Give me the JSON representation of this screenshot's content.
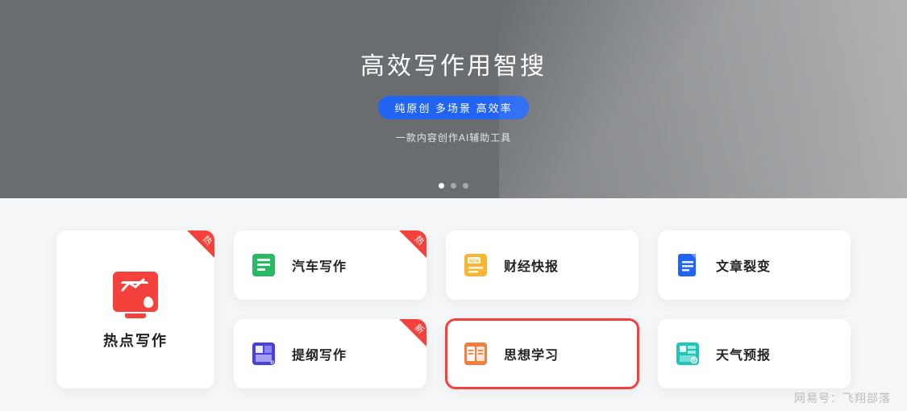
{
  "hero": {
    "title": "高效写作用智搜",
    "pill": "纯原创 多场景 高效率",
    "subtitle": "一款内容创作AI辅助工具"
  },
  "ribbons": {
    "hot": "热",
    "new": "新"
  },
  "featured": {
    "label": "热点写作",
    "color": "#f4413b"
  },
  "cards": [
    {
      "label": "汽车写作",
      "color": "#2ab964",
      "ribbon": "hot"
    },
    {
      "label": "财经快报",
      "color": "#f7b530"
    },
    {
      "label": "文章裂变",
      "color": "#2164f4"
    },
    {
      "label": "提纲写作",
      "color": "#4a3fe0",
      "ribbon": "new"
    },
    {
      "label": "思想学习",
      "color": "#f2803a",
      "highlight": true
    },
    {
      "label": "天气预报",
      "color": "#1ec6b8"
    }
  ],
  "watermark": "网易号：飞翔部落"
}
